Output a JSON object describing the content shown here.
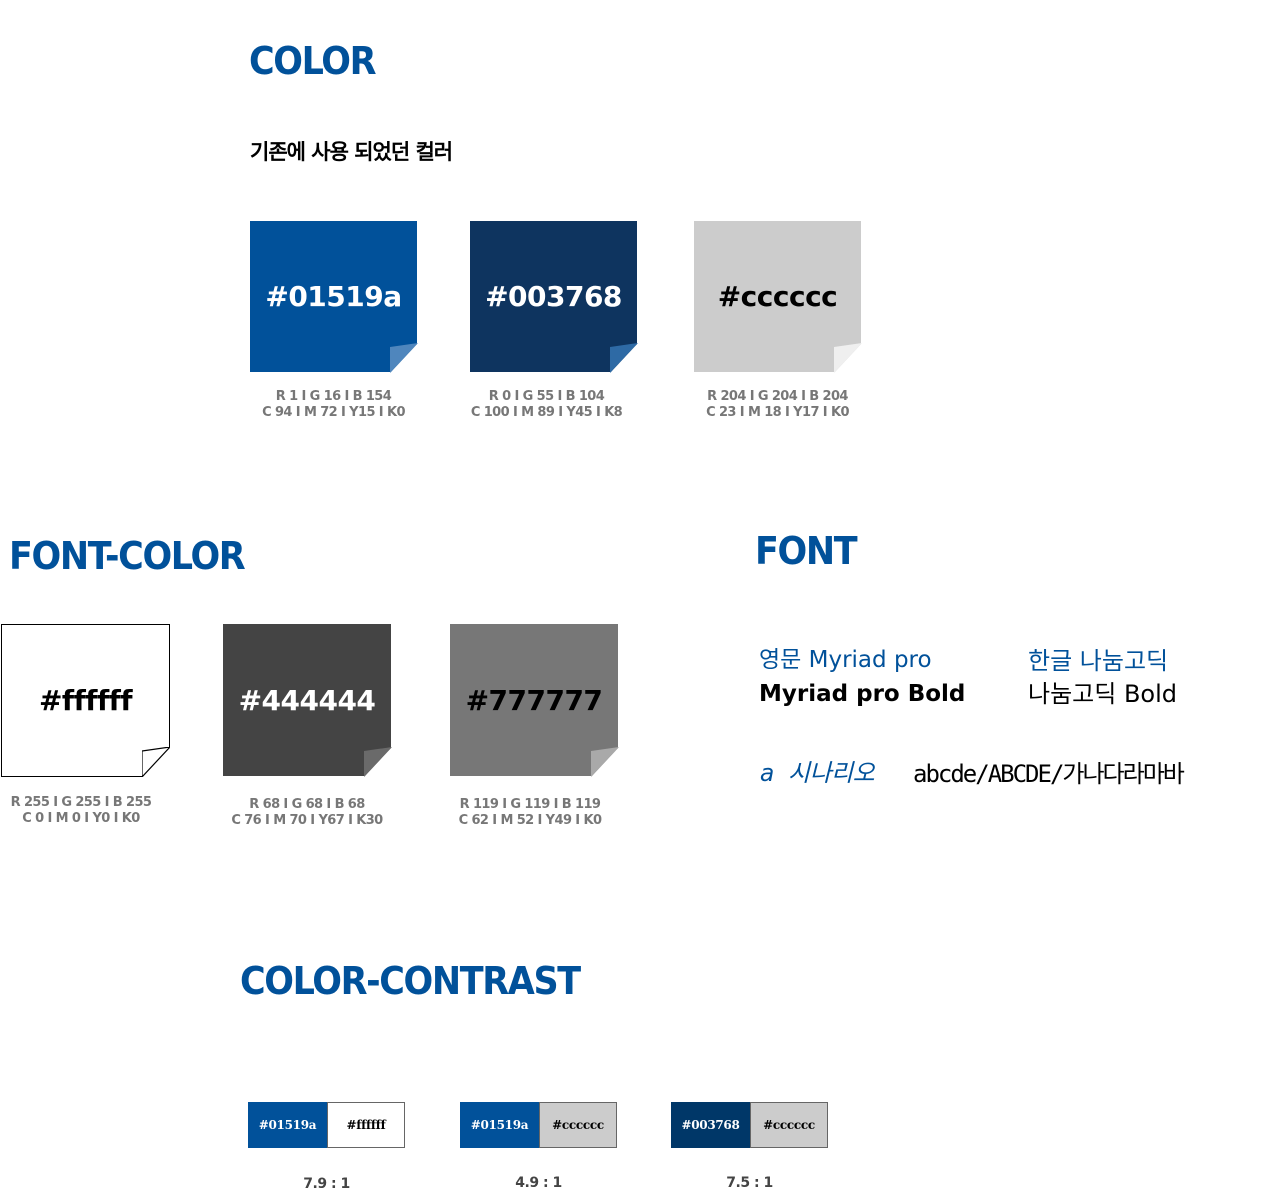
{
  "sections": {
    "color_title": "COLOR",
    "color_subtitle": "기존에 사용 되었던 컬러",
    "font_color_title": "FONT-COLOR",
    "font_title": "FONT",
    "contrast_title": "COLOR-CONTRAST"
  },
  "brand_colors": [
    {
      "hex": "#01519a",
      "fill": "#01519a",
      "text_color": "#ffffff",
      "curl": "#4f86bd",
      "rgb": "R 1 I G 16 I B 154",
      "cmyk": "C 94 I M 72 I Y15 I K0"
    },
    {
      "hex": "#003768",
      "fill": "#0e345f",
      "text_color": "#ffffff",
      "curl": "#2e6aa5",
      "rgb": "R 0 I G 55 I B 104",
      "cmyk": "C 100 I M 89 I Y45 I K8"
    },
    {
      "hex": "#cccccc",
      "fill": "#cccccc",
      "text_color": "#000000",
      "curl": "#efefef",
      "rgb": "R 204 I G 204 I B 204",
      "cmyk": "C 23 I M 18 I Y17 I K0"
    }
  ],
  "font_colors": [
    {
      "hex": "#ffffff",
      "fill": "#ffffff",
      "text_color": "#000000",
      "curl": "#ffffff",
      "rgb": "R 255 I G 255 I B 255",
      "cmyk": "C 0 I M 0 I Y0 I K0"
    },
    {
      "hex": "#444444",
      "fill": "#444444",
      "text_color": "#ffffff",
      "curl": "#6a6a6a",
      "rgb": "R 68 I G 68 I B 68",
      "cmyk": "C 76 I M 70 I Y67 I K30"
    },
    {
      "hex": "#777777",
      "fill": "#777777",
      "text_color": "#000000",
      "curl": "#a9a9a9",
      "rgb": "R 119 I G 119 I B 119",
      "cmyk": "C 62 I M 52 I Y49 I K0"
    }
  ],
  "fonts": {
    "english_label": "영문 Myriad pro",
    "english_bold": "Myriad pro Bold",
    "korean_label": "한글 나눔고딕",
    "korean_bold": "나눔고딕 Bold",
    "script_sample_label": "a 시나리오",
    "script_sample_text": "abcde/ABCDE/가나다라마바"
  },
  "contrast_pairs": [
    {
      "bg": {
        "hex": "#01519a",
        "fill": "#01519a",
        "text_color": "#ffffff"
      },
      "fg": {
        "hex": "#ffffff",
        "fill": "#ffffff",
        "text_color": "#000000"
      },
      "ratio": "7.9 : 1"
    },
    {
      "bg": {
        "hex": "#01519a",
        "fill": "#01519a",
        "text_color": "#ffffff"
      },
      "fg": {
        "hex": "#cccccc",
        "fill": "#cccccc",
        "text_color": "#000000"
      },
      "ratio": "4.9 : 1"
    },
    {
      "bg": {
        "hex": "#003768",
        "fill": "#003768",
        "text_color": "#ffffff"
      },
      "fg": {
        "hex": "#cccccc",
        "fill": "#cccccc",
        "text_color": "#000000"
      },
      "ratio": "7.5 : 1"
    }
  ]
}
